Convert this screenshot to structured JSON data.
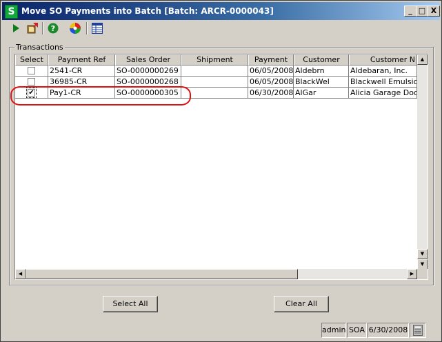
{
  "window": {
    "title": "Move SO Payments into Batch  [Batch: ARCR-0000043]",
    "app_icon_letter": "S",
    "min_label": "_",
    "max_label": "□",
    "close_label": "X"
  },
  "toolbar": {
    "icons": [
      "play-icon",
      "export-icon",
      "help-icon",
      "color-wheel-icon",
      "grid-settings-icon"
    ]
  },
  "transactions": {
    "label": "Transactions",
    "columns": [
      "Select",
      "Payment Ref",
      "Sales Order",
      "Shipment",
      "Payment",
      "Customer",
      "Customer N"
    ],
    "rows": [
      {
        "selected": false,
        "payment_ref": "2541-CR",
        "sales_order": "SO-0000000269",
        "shipment": "",
        "payment": "06/05/2008",
        "customer": "Aldebrn",
        "customer_name": "Aldebaran, Inc."
      },
      {
        "selected": false,
        "payment_ref": "36985-CR",
        "sales_order": "SO-0000000268",
        "shipment": "",
        "payment": "06/05/2008",
        "customer": "BlackWel",
        "customer_name": "Blackwell Emulsion"
      },
      {
        "selected": true,
        "payment_ref": "Pay1-CR",
        "sales_order": "SO-0000000305",
        "shipment": "",
        "payment": "06/30/2008",
        "customer": "AlGar",
        "customer_name": "Alicia Garage Doors"
      }
    ]
  },
  "buttons": {
    "select_all": "Select All",
    "clear_all": "Clear All"
  },
  "status": {
    "user": "admin",
    "company": "SOA",
    "date": "6/30/2008"
  },
  "colors": {
    "title_gradient_start": "#0a246a",
    "annotation_red": "#e01010",
    "app_icon_green": "#11a83b"
  }
}
